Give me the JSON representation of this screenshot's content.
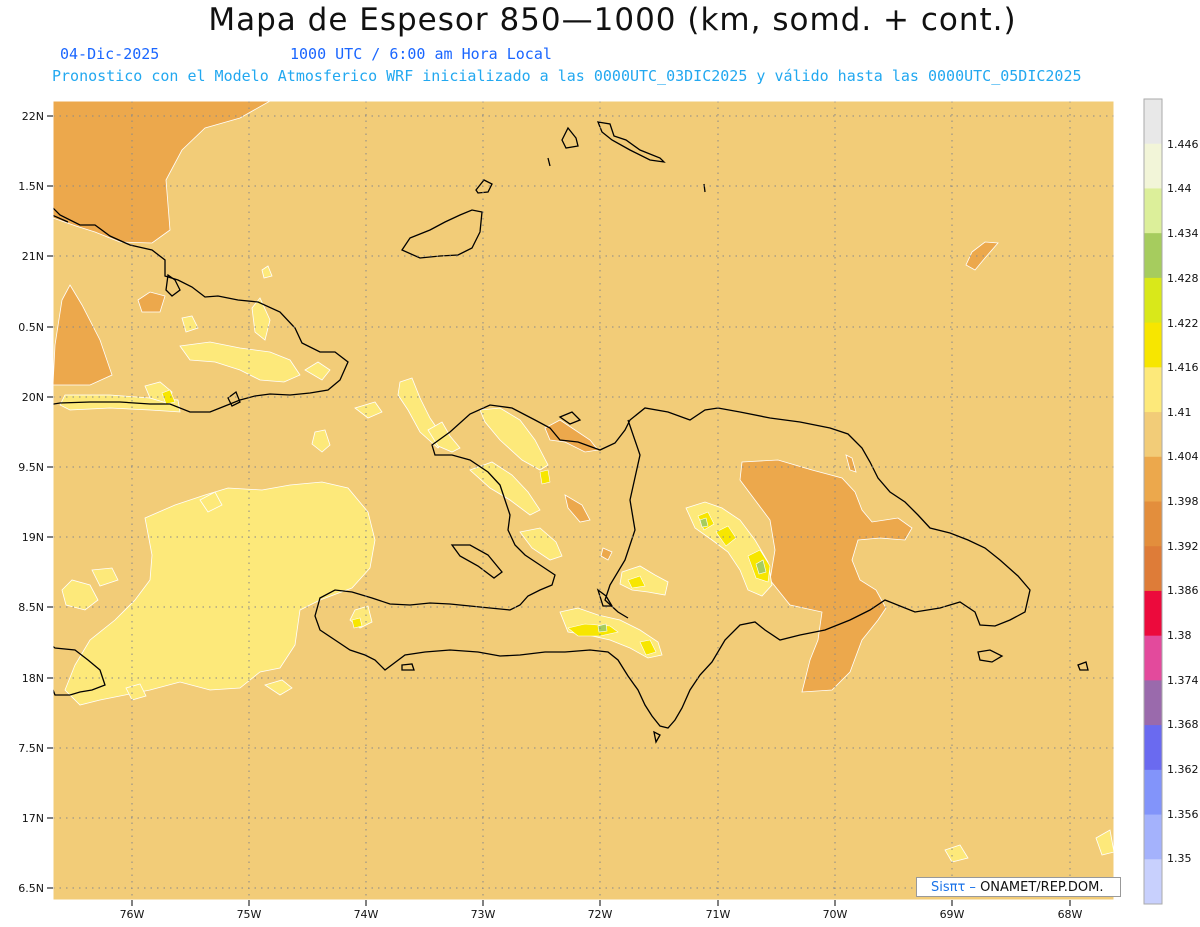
{
  "header": {
    "title": "Mapa de Espesor 850—1000 (km, somd. + cont.)",
    "date": "04-Dic-2025",
    "time": "1000 UTC / 6:00 am Hora Local",
    "model_info": "Pronostico con el Modelo Atmosferico WRF inicializado a las 0000UTC_03DIC2025 y válido hasta las  0000UTC_05DIC2025"
  },
  "axes": {
    "lat_labels": [
      "22N",
      "1.5N",
      "21N",
      "0.5N",
      "20N",
      "9.5N",
      "19N",
      "8.5N",
      "18N",
      "7.5N",
      "17N",
      "6.5N"
    ],
    "lon_labels": [
      "76W",
      "75W",
      "74W",
      "73W",
      "72W",
      "71W",
      "70W",
      "69W",
      "68W"
    ]
  },
  "colorbar": {
    "labels": [
      "1.446",
      "1.44",
      "1.434",
      "1.428",
      "1.422",
      "1.416",
      "1.41",
      "1.404",
      "1.398",
      "1.392",
      "1.386",
      "1.38",
      "1.374",
      "1.368",
      "1.362",
      "1.356",
      "1.35"
    ],
    "colors": [
      "#e8e8e8",
      "#f2f5d8",
      "#dcef9a",
      "#a6cc5e",
      "#d9e81a",
      "#f7e600",
      "#fde97a",
      "#f2cc78",
      "#eca84c",
      "#e38e3c",
      "#de7c38",
      "#ec0a3c",
      "#e34a9c",
      "#9a6aac",
      "#6a6af0",
      "#8294fa",
      "#a4b2fc",
      "#c8d0fd"
    ]
  },
  "map": {
    "background_color": "#f2cc78",
    "warm_color": "#eca84c",
    "warmer_color": "#e38e3c",
    "light_color": "#fde97a",
    "yellow_color": "#f7e600",
    "green_color": "#a6cc5e"
  },
  "credit": {
    "prefix": "Sisπτ –",
    "org": "ONAMET/REP.DOM."
  }
}
